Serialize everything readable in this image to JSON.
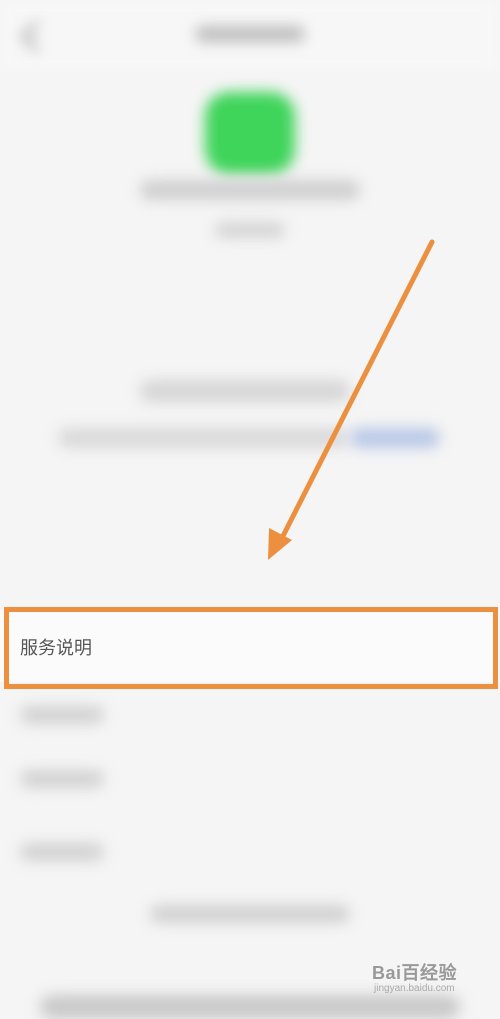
{
  "screen": {
    "service_item_label": "服务说明"
  },
  "annotation": {
    "color": "#ec8f3f"
  },
  "watermark": {
    "brand": "Bai百经验",
    "sub": "jingyan.baidu.com"
  },
  "colors": {
    "app_logo": "#3fd45a",
    "background": "#f5f5f5",
    "link": "#b9c8e6"
  }
}
